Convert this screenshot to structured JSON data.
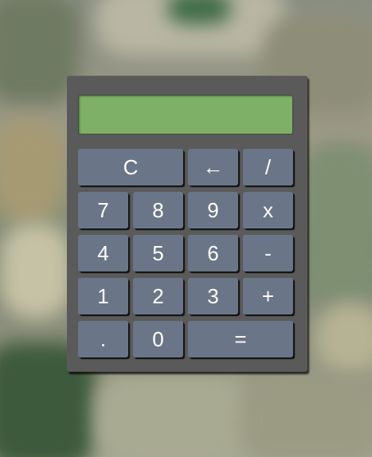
{
  "calculator": {
    "display_value": "",
    "display_color": "#7fb068",
    "key_color": "#6b7588",
    "body_color": "#5a5a5a",
    "keys": {
      "clear": "C",
      "backspace": "←",
      "divide": "/",
      "seven": "7",
      "eight": "8",
      "nine": "9",
      "multiply": "x",
      "four": "4",
      "five": "5",
      "six": "6",
      "subtract": "-",
      "one": "1",
      "two": "2",
      "three": "3",
      "add": "+",
      "decimal": ".",
      "zero": "0",
      "equals": "="
    }
  }
}
